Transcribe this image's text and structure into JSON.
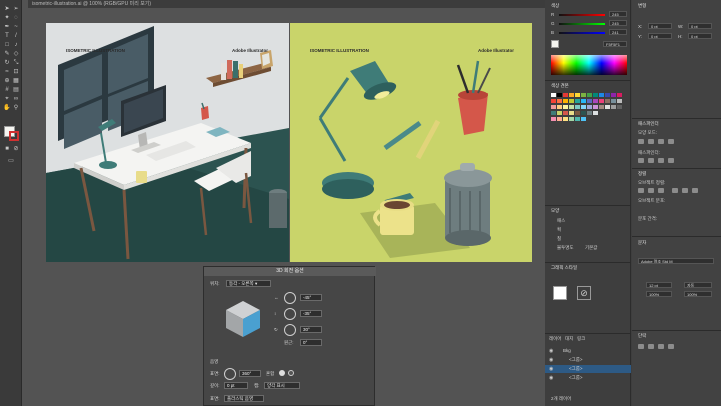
{
  "window": {
    "tab_title": "isometric-illustration.ai @ 100% (RGB/GPU 미리 보기)"
  },
  "artboards": {
    "left": {
      "title": "ISOMETRIC ILLUSTRATION",
      "brand": "Adobe Illustrator",
      "background": "#dde0e1",
      "floor": "#2c5350",
      "wall_accent": "#3a4a52"
    },
    "right": {
      "title": "ISOMETRIC ILLUSTRATION",
      "brand": "Adobe Illustrator",
      "background": "#c9d46a"
    }
  },
  "dialog": {
    "title": "3D 회전 옵션",
    "position_label": "위치:",
    "position_value": "등각 - 오른쪽",
    "rot_x": "-45°",
    "rot_y": "-35°",
    "rot_z": "30°",
    "perspective_label": "원근:",
    "perspective_value": "0°",
    "shading_section": "음영",
    "surface_label": "표면:",
    "surface_value": "360°",
    "blend_label": "혼합",
    "depth_label": "깊이:",
    "depth_value": "0 pt",
    "cap_label": "캡:",
    "cap_value": "양각 표시",
    "surface_type_label": "표면:",
    "surface_type_value": "플라스틱 음영"
  },
  "panels": {
    "color": {
      "title": "색상",
      "r": "245",
      "g": "245",
      "b": "241",
      "hex": "F5F5F1"
    },
    "swatches_title": "색상 견본",
    "appearance": {
      "title": "모양",
      "path_label": "패스",
      "stroke_label": "획",
      "fill_label": "칠",
      "opacity_label": "불투명도",
      "opacity_value": "기본값"
    },
    "layers": {
      "title": "레이어",
      "tabs": [
        "레이어",
        "대지",
        "링크"
      ],
      "rows": [
        "Bkg",
        "<그룹>",
        "<그룹>",
        "<그룹>",
        "<그룹>",
        "<그룹>"
      ],
      "count": "2개 레이어"
    },
    "graphic_styles_title": "그래픽 스타일",
    "transform": {
      "title": "변형",
      "x_label": "X:",
      "x_value": "0 pt",
      "y_label": "Y:",
      "y_value": "0 pt",
      "w_label": "W:",
      "w_value": "0 pt",
      "h_label": "H:",
      "h_value": "0 pt"
    },
    "character": {
      "title": "문자",
      "font": "Adobe 명조 Std M",
      "size": "12 pt",
      "leading": "자동",
      "scale_h": "100%",
      "scale_v": "100%"
    },
    "align_title": "정렬",
    "align_objects": "오브젝트 정렬:",
    "distribute_objects": "오브젝트 분포:",
    "distribute_spacing": "분포 간격:",
    "pathfinder_title": "패스파인더",
    "pathfinder_shape_modes": "모양 모드:",
    "pathfinder_label": "패스파인더:",
    "paragraph_title": "단락"
  },
  "colors": {
    "app_bg": "#535353",
    "panel_bg": "#3e3e3e",
    "accent_blue": "#4a9fe0"
  }
}
